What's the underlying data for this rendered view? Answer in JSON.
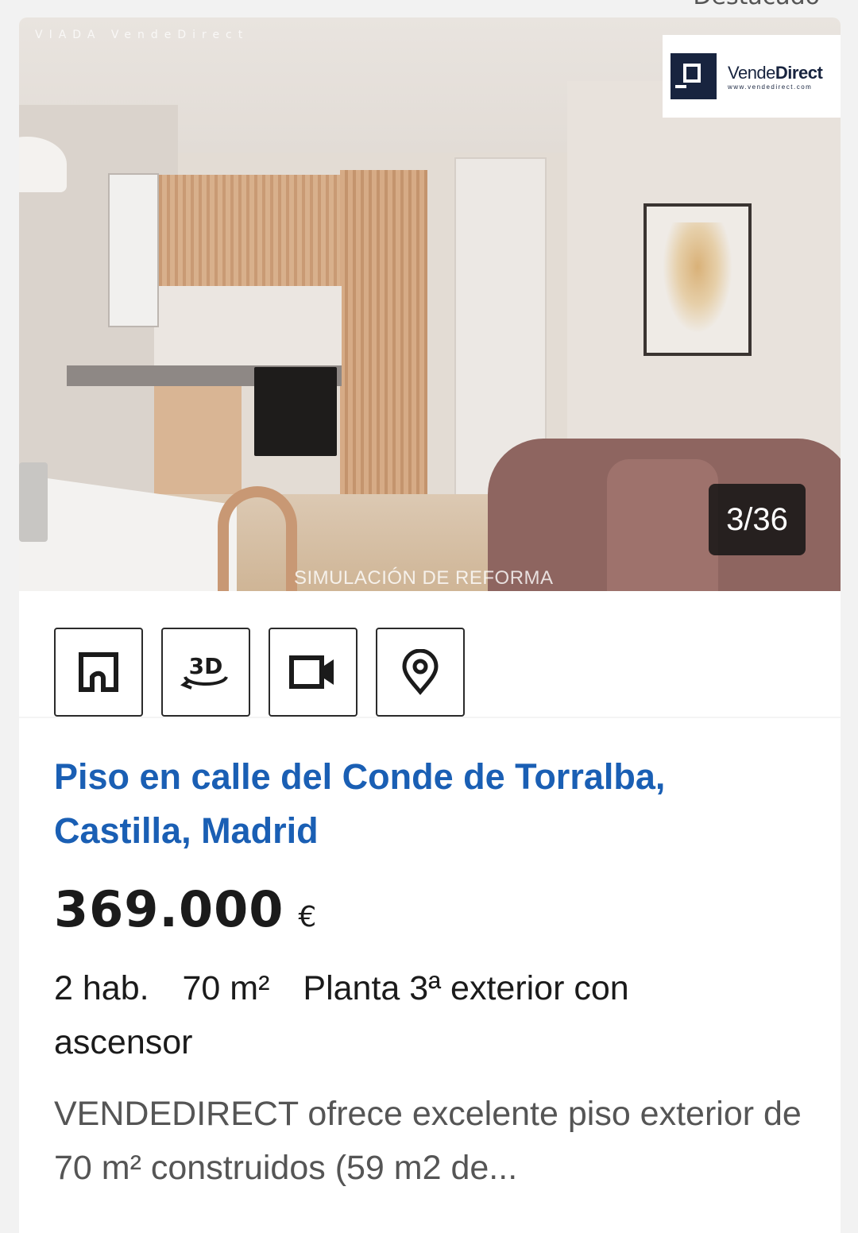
{
  "header": {
    "featured_label": "Destacado"
  },
  "photo": {
    "watermark_top": "VIADA  VendeDirect",
    "watermark_bottom": "SIMULACIÓN DE REFORMA",
    "logo": {
      "word_regular": "Vende",
      "word_bold": "Direct",
      "url": "www.vendedirect.com"
    },
    "counter": "3/36"
  },
  "features": [
    {
      "name": "floor-plan-icon"
    },
    {
      "name": "3d-tour-icon",
      "glyph": "3D"
    },
    {
      "name": "video-icon"
    },
    {
      "name": "map-pin-icon"
    }
  ],
  "listing": {
    "title": "Piso en calle del Conde de Torralba, Castilla, Madrid",
    "price": "369.000",
    "currency": "€",
    "rooms": "2 hab.",
    "area": "70 m²",
    "floor": "Planta 3ª exterior con ascensor",
    "description": "VENDEDIRECT ofrece excelente piso exterior de 70 m² construidos (59 m2 de..."
  },
  "colors": {
    "title_blue": "#1a5fb4",
    "logo_navy": "#18243f",
    "sofa": "#8e6560"
  }
}
